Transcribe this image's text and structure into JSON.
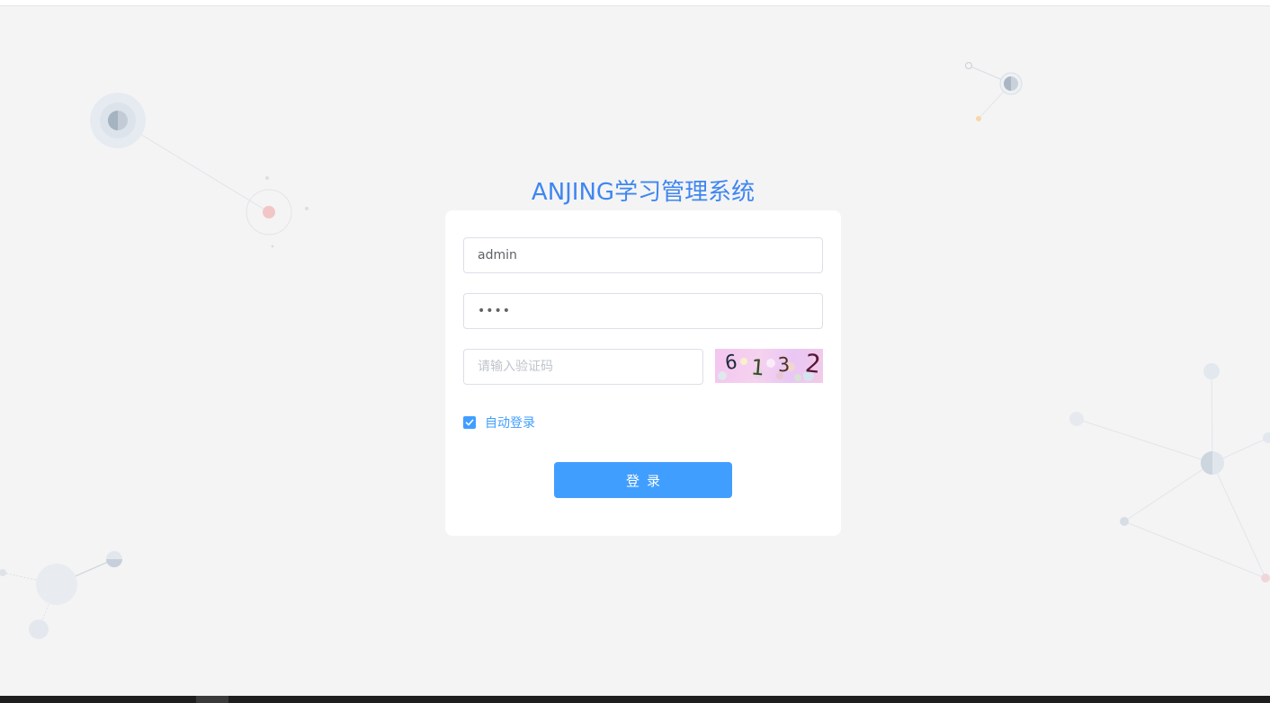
{
  "app": {
    "title": "ANJING学习管理系统"
  },
  "form": {
    "username_value": "admin",
    "password_value": "••••",
    "captcha_placeholder": "请输入验证码",
    "captcha_digits": [
      "6",
      "1",
      "3",
      "2"
    ],
    "remember_label": "自动登录",
    "remember_checked": true,
    "login_label": "登录"
  },
  "colors": {
    "accent": "#409eff",
    "title": "#3f86f0",
    "background": "#f4f4f5",
    "card": "#ffffff"
  },
  "icons": [
    "check-icon"
  ]
}
